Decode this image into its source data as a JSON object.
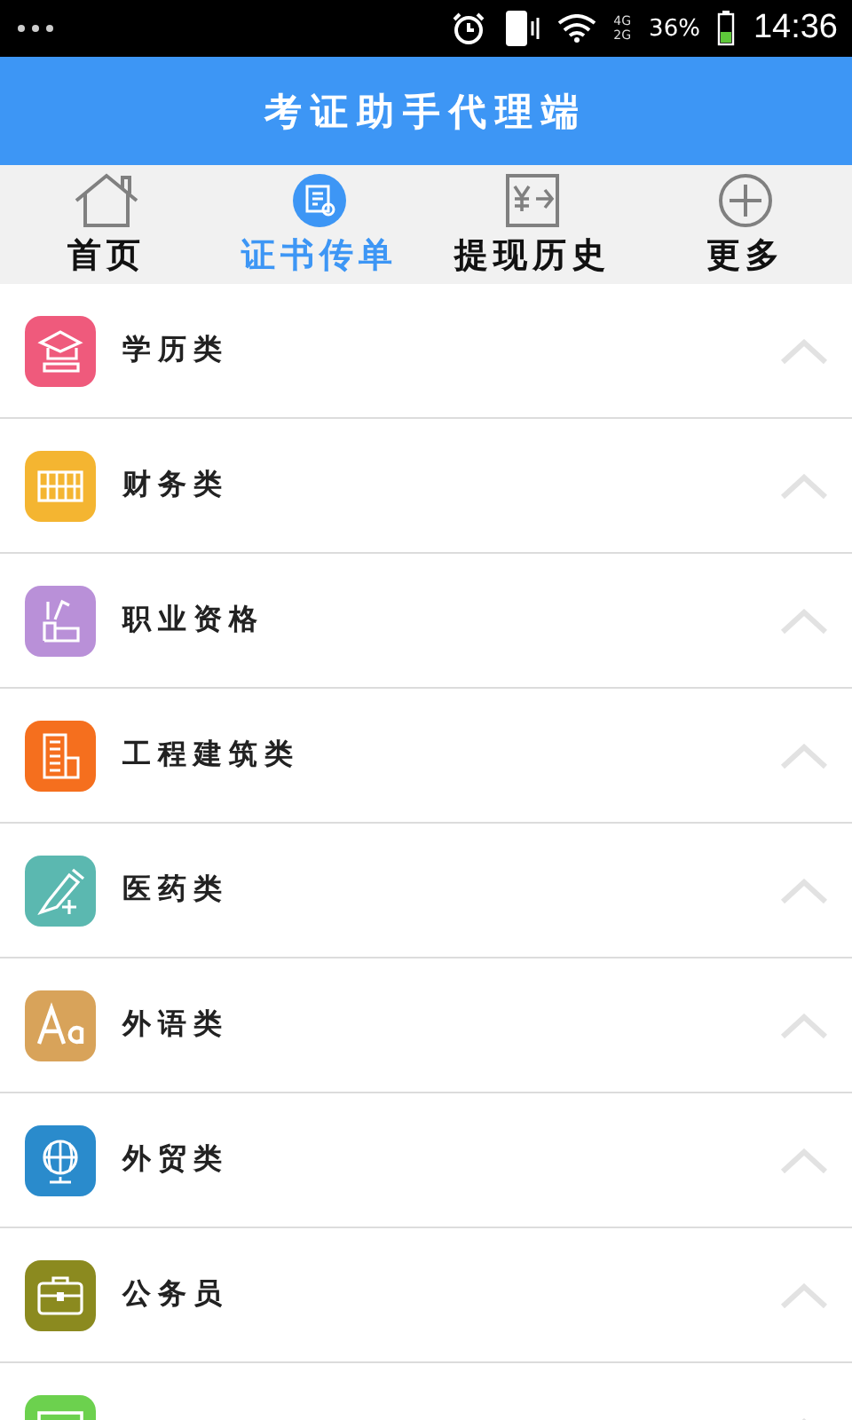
{
  "status_bar": {
    "network_1": "4G",
    "network_2": "2G",
    "battery": "36%",
    "time": "14:36"
  },
  "header": {
    "title": "考证助手代理端"
  },
  "tabs": [
    {
      "label": "首页",
      "kind": "home",
      "selected": false
    },
    {
      "label": "证书传单",
      "kind": "certificate",
      "selected": true
    },
    {
      "label": "提现历史",
      "kind": "cash",
      "selected": false
    },
    {
      "label": "更多",
      "kind": "plus",
      "selected": false
    }
  ],
  "categories": [
    {
      "label": "学历类",
      "kind": "graduation",
      "color": "#ef5a7c"
    },
    {
      "label": "财务类",
      "kind": "abacus",
      "color": "#f4b531"
    },
    {
      "label": "职业资格",
      "kind": "tools",
      "color": "#b990d8"
    },
    {
      "label": "工程建筑类",
      "kind": "building",
      "color": "#f56f1e"
    },
    {
      "label": "医药类",
      "kind": "syringe",
      "color": "#5bb8b0"
    },
    {
      "label": "外语类",
      "kind": "letters",
      "color": "#d8a35a"
    },
    {
      "label": "外贸类",
      "kind": "globe",
      "color": "#2a8bcc"
    },
    {
      "label": "公务员",
      "kind": "briefcase",
      "color": "#8b8a1f"
    },
    {
      "kind": "monitor",
      "color": "#6cd14e"
    }
  ]
}
